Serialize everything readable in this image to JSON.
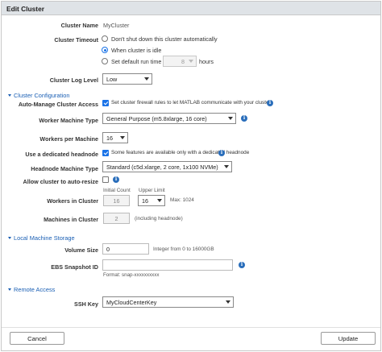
{
  "dialog": {
    "title": "Edit Cluster"
  },
  "cluster_name": {
    "label": "Cluster Name",
    "value": "MyCluster"
  },
  "cluster_timeout": {
    "label": "Cluster Timeout",
    "options": [
      {
        "label": "Don't shut down this cluster automatically",
        "selected": false
      },
      {
        "label": "When cluster is idle",
        "selected": true
      },
      {
        "label": "Set default run time to",
        "selected": false
      }
    ],
    "run_time_value": "8",
    "run_time_unit": "hours"
  },
  "log_level": {
    "label": "Cluster Log Level",
    "value": "Low"
  },
  "cluster_configuration": {
    "section_label": "Cluster Configuration",
    "auto_manage": {
      "label": "Auto-Manage Cluster Access",
      "checked": true,
      "text": "Set cluster firewall rules to let MATLAB communicate with your cluster."
    },
    "worker_machine_type": {
      "label": "Worker Machine Type",
      "value": "General Purpose (m5.8xlarge, 16 core)"
    },
    "workers_per_machine": {
      "label": "Workers per Machine",
      "value": "16"
    },
    "dedicated_headnode": {
      "label": "Use a dedicated headnode",
      "checked": true,
      "text": "Some features are available only with a dedicated headnode"
    },
    "headnode_machine_type": {
      "label": "Headnode Machine Type",
      "value": "Standard (c5d.xlarge, 2 core, 1x100 NVMe)"
    },
    "auto_resize": {
      "label": "Allow cluster to auto-resize",
      "checked": false
    },
    "workers_in_cluster": {
      "label": "Workers in Cluster",
      "initial_count_label": "Initial Count",
      "initial_count": "16",
      "upper_limit_label": "Upper Limit",
      "upper_limit": "16",
      "max_text": "Max: 1024"
    },
    "machines_in_cluster": {
      "label": "Machines in Cluster",
      "value": "2",
      "note": "(including headnode)"
    }
  },
  "local_storage": {
    "section_label": "Local Machine Storage",
    "volume_size": {
      "label": "Volume Size",
      "value": "0",
      "hint": "Integer from 0 to 16000GB"
    },
    "ebs_snapshot": {
      "label": "EBS Snapshot ID",
      "value": "",
      "format_hint": "Format: snap-xxxxxxxxxx"
    }
  },
  "remote_access": {
    "section_label": "Remote Access",
    "ssh_key": {
      "label": "SSH Key",
      "value": "MyCloudCenterKey"
    }
  },
  "buttons": {
    "cancel": "Cancel",
    "update": "Update"
  },
  "icons": {
    "info": "i"
  },
  "colors": {
    "accent": "#1a73e8",
    "section": "#1a5fb4",
    "info": "#2a6ebb",
    "titlebar": "#dfe3e7"
  }
}
